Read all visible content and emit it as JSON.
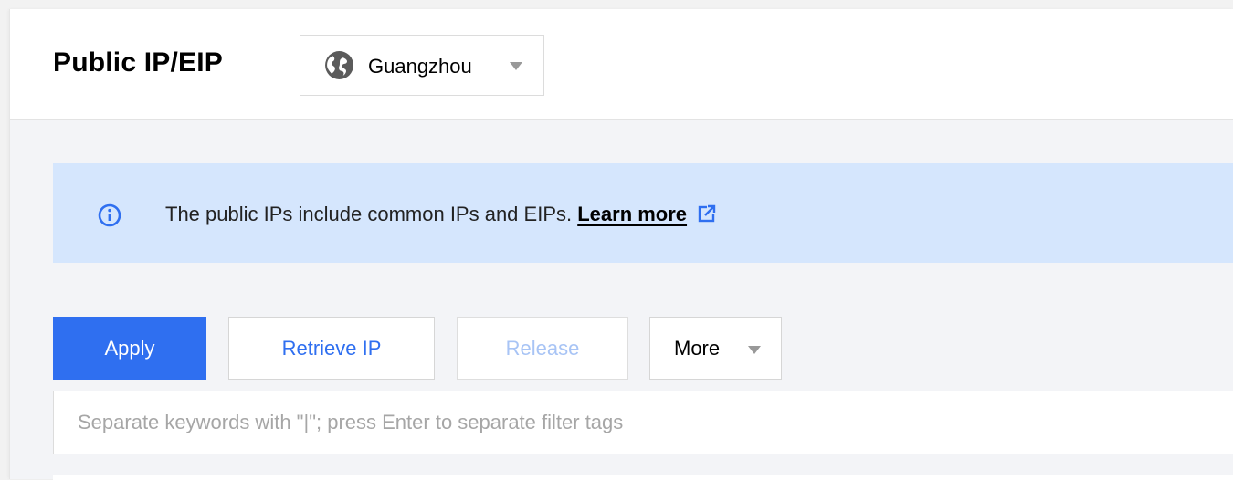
{
  "header": {
    "title": "Public IP/EIP",
    "region": {
      "label": "Guangzhou",
      "icon": "globe-icon"
    }
  },
  "notice": {
    "icon": "info-icon",
    "text": "The public IPs include common IPs and EIPs. ",
    "link_label": "Learn more",
    "link_icon": "external-link-icon"
  },
  "toolbar": {
    "apply_label": "Apply",
    "retrieve_label": "Retrieve IP",
    "release_label": "Release",
    "more_label": "More"
  },
  "search": {
    "placeholder": "Separate keywords with \"|\"; press Enter to separate filter tags",
    "value": ""
  },
  "colors": {
    "primary": "#2f6ff0",
    "notice_bg": "#d5e6fd",
    "disabled_text": "#a8c4f5",
    "page_bg": "#f3f4f7"
  }
}
